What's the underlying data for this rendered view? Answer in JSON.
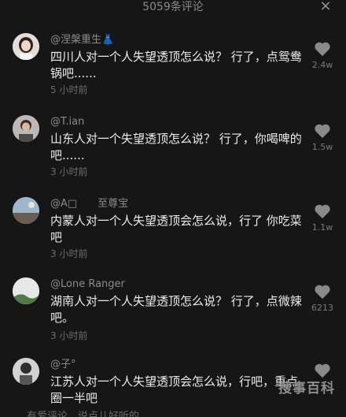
{
  "header": {
    "title": "5059条评论",
    "close_icon": "×"
  },
  "comments": [
    {
      "user": "@涅槃重生👗",
      "text": "四川人对一个人失望透顶怎么说？ 行了，点鸳鸯锅吧......",
      "time": "5 小时前",
      "likes": "2.4w",
      "avatar_icon": "girl-avatar"
    },
    {
      "user": "@T.ian",
      "text": "山东人对一个失望透顶怎么说？ 行了，你喝啤的吧......",
      "time": "3 小时前",
      "likes": "1.5w",
      "avatar_icon": "person-avatar"
    },
    {
      "user": "@A□　　至尊宝",
      "text": "内蒙人对一个人失望透顶会怎么说，行了 你吃菜吧",
      "time": "3 小时前",
      "likes": "1.1w",
      "avatar_icon": "sky-avatar"
    },
    {
      "user": "@Lone Ranger",
      "text": "湖南人对一个人失望透顶怎么说？ 行了，点微辣吧。",
      "time": "3 小时前",
      "likes": "6213",
      "avatar_icon": "landscape-avatar"
    },
    {
      "user": "@子°",
      "text": "江苏人对一个人失望透顶会怎么说，行吧，重点圈一半吧",
      "time": "",
      "likes": "",
      "avatar_icon": "person-avatar"
    }
  ],
  "footer": {
    "input_placeholder": "有爱评论，说点儿好听的"
  },
  "watermark": "搜事百科",
  "colors": {
    "background": "#161616",
    "text": "#ececec",
    "muted": "#8b8b8b"
  }
}
